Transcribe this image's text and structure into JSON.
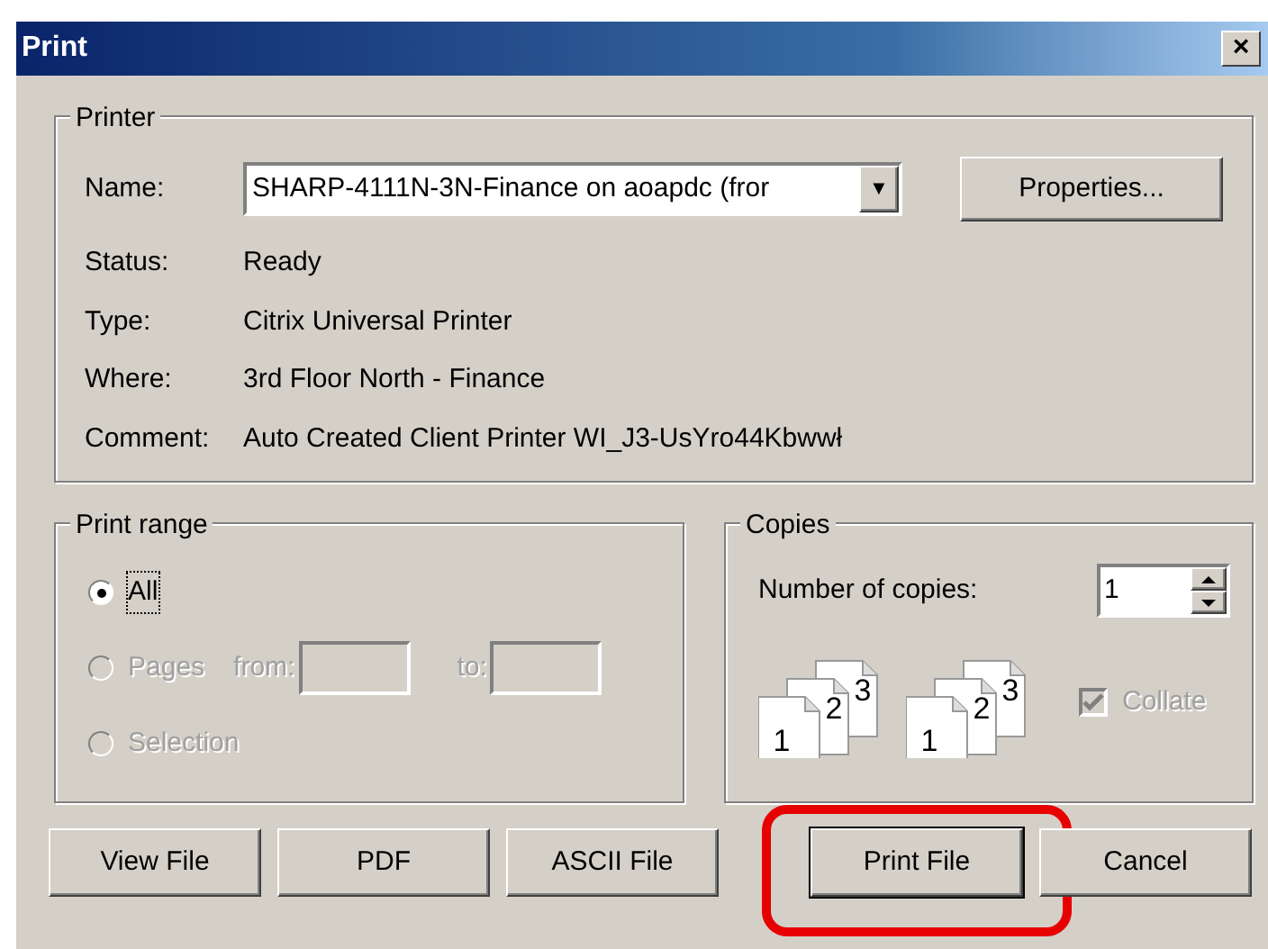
{
  "window": {
    "title": "Print",
    "close": "×"
  },
  "printer": {
    "legend": "Printer",
    "name_label": "Name:",
    "name_value": "SHARP-4111N-3N-Finance on aoapdc (fror",
    "dropdown_arrow": "▼",
    "properties_button": "Properties...",
    "info": [
      {
        "label": "Status:",
        "value": "Ready"
      },
      {
        "label": "Type:",
        "value": "Citrix Universal Printer"
      },
      {
        "label": "Where:",
        "value": "3rd Floor North - Finance"
      },
      {
        "label": "Comment:",
        "value": "Auto Created Client Printer WI_J3-UsYro44Kbwwł"
      }
    ]
  },
  "print_range": {
    "legend": "Print range",
    "options": [
      {
        "label": "All",
        "selected": true,
        "disabled": false,
        "kind": "plain"
      },
      {
        "label": "Pages",
        "selected": false,
        "disabled": true,
        "kind": "pages",
        "from_label": "from:",
        "to_label": "to:"
      },
      {
        "label": "Selection",
        "selected": false,
        "disabled": true,
        "kind": "plain"
      }
    ]
  },
  "copies": {
    "legend": "Copies",
    "count_label": "Number of copies:",
    "count_value": "1",
    "stacks": [
      {
        "pages": [
          "1",
          "2",
          "3"
        ]
      },
      {
        "pages": [
          "1",
          "2",
          "3"
        ]
      }
    ],
    "collate": {
      "label": "Collate",
      "checked": true,
      "disabled": true
    }
  },
  "buttons": [
    {
      "label": "View File",
      "default": false,
      "highlighted": false
    },
    {
      "label": "PDF",
      "default": false,
      "highlighted": false
    },
    {
      "label": "ASCII File",
      "default": false,
      "highlighted": false
    },
    {
      "label": "Print File",
      "default": true,
      "highlighted": true
    },
    {
      "label": "Cancel",
      "default": false,
      "highlighted": false
    }
  ]
}
